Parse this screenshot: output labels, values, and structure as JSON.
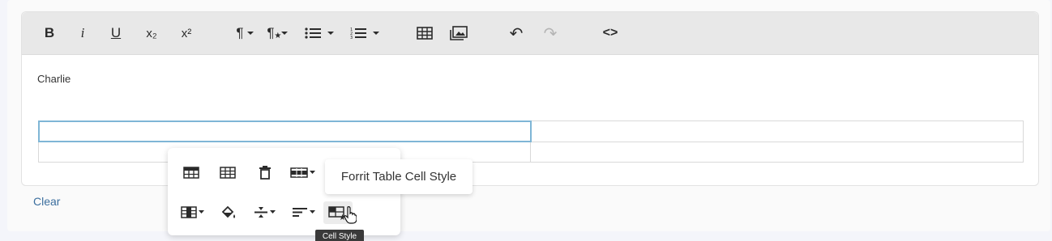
{
  "toolbar": {
    "bold": "B",
    "italic": "i",
    "underline": "U",
    "subscript": "x₂",
    "superscript": "x²",
    "paragraph": "¶",
    "undo": "↶",
    "redo": "↷",
    "code_view": "<>"
  },
  "editor": {
    "content_text": "Charlie"
  },
  "actions": {
    "clear_label": "Clear"
  },
  "table_popup": {
    "hover_tooltip": "Forrit Table Cell Style",
    "button_tooltip": "Cell Style"
  },
  "colors": {
    "accent": "#3b6e9e",
    "selection_border": "#7fb6d6",
    "toolbar_bg": "#e8e8e8"
  }
}
